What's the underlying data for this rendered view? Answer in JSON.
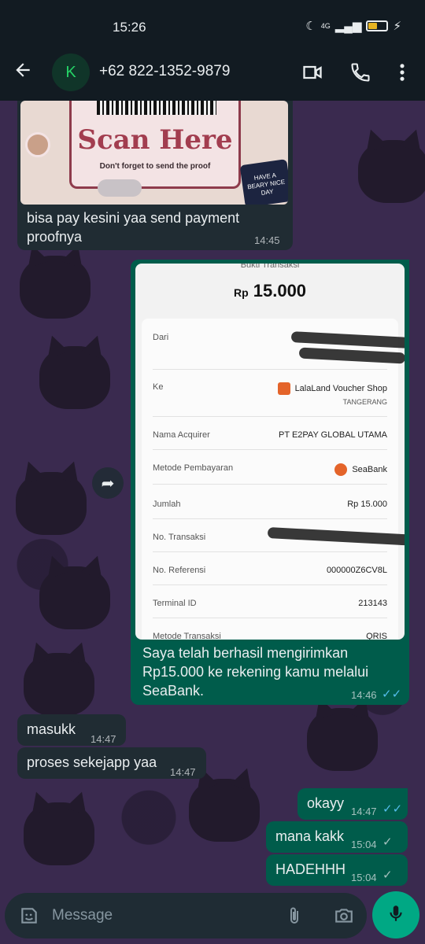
{
  "status_bar": {
    "time": "15:26",
    "network": "4G"
  },
  "header": {
    "back_icon": "arrow-left-icon",
    "avatar_letter": "K",
    "contact_name": "+62 822-1352-9879",
    "video_icon": "video-call-icon",
    "call_icon": "phone-icon",
    "menu_icon": "more-vertical-icon"
  },
  "messages": [
    {
      "direction": "incoming",
      "image": {
        "title": "Scan Here",
        "subtitle": "Don't forget to send the proof",
        "badge": "HAVE A BEARY NICE DAY"
      },
      "text": "bisa pay kesini yaa send payment proofnya",
      "time": "14:45"
    },
    {
      "direction": "outgoing",
      "image": {
        "header": "Bukti Transaksi",
        "currency": "Rp",
        "amount": "15.000",
        "rows": [
          {
            "label": "Dari",
            "value": ""
          },
          {
            "label": "Ke",
            "value": "LalaLand Voucher Shop",
            "sub": "TANGERANG"
          },
          {
            "label": "Nama Acquirer",
            "value": "PT E2PAY GLOBAL UTAMA"
          },
          {
            "label": "Metode Pembayaran",
            "value": "SeaBank"
          },
          {
            "label": "Jumlah",
            "value": "Rp 15.000"
          },
          {
            "label": "No. Transaksi",
            "value": ""
          },
          {
            "label": "No. Referensi",
            "value": "000000Z6CV8L"
          },
          {
            "label": "Terminal ID",
            "value": "213143"
          },
          {
            "label": "Metode Transaksi",
            "value": "QRIS"
          }
        ]
      },
      "text": "Saya telah berhasil mengirimkan Rp15.000 ke rekening kamu melalui SeaBank.",
      "time": "14:46",
      "status": "read"
    },
    {
      "direction": "incoming",
      "text": "masukk",
      "time": "14:47"
    },
    {
      "direction": "incoming",
      "text": "proses sekejapp yaa",
      "time": "14:47"
    },
    {
      "direction": "outgoing",
      "text": "okayy",
      "time": "14:47",
      "status": "read"
    },
    {
      "direction": "outgoing",
      "text": "mana kakk",
      "time": "15:04",
      "status": "sent"
    },
    {
      "direction": "outgoing",
      "text": "HADEHHH",
      "time": "15:04",
      "status": "sent"
    }
  ],
  "input": {
    "placeholder": "Message",
    "emoji_icon": "sticker-icon",
    "attach_icon": "paperclip-icon",
    "camera_icon": "camera-icon",
    "mic_icon": "microphone-icon"
  },
  "colors": {
    "incoming_bubble": "#202c33",
    "outgoing_bubble": "#005c4b",
    "read_ticks": "#53bdeb",
    "mic_button": "#00a884",
    "header_bg": "#121b22"
  }
}
